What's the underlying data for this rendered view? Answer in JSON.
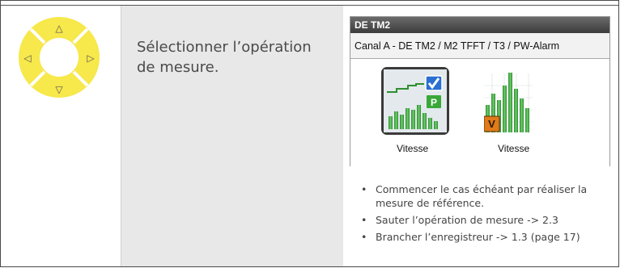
{
  "step": {
    "instruction": "Sélectionner l’opération de mesure."
  },
  "nav_keys": {
    "up": "△",
    "down": "▽",
    "left": "◁",
    "right": "▷",
    "color": "#f7e84b"
  },
  "device": {
    "title": "DE TM2",
    "channel": "Canal A - DE TM2 / M2 TFFT / T3 / PW-Alarm",
    "options": [
      {
        "label": "Vitesse",
        "icon": "speed-trend-icon",
        "badges": [
          "P"
        ],
        "selected": true
      },
      {
        "label": "Vitesse",
        "icon": "speed-spectrum-icon",
        "badges": [
          "V"
        ],
        "selected": false
      }
    ]
  },
  "notes": [
    "Commencer le cas échéant par réaliser la mesure de référence.",
    "Sauter l’opération de mesure -> 2.3",
    "Brancher l’enregistreur -> 1.3 (page 17)"
  ]
}
